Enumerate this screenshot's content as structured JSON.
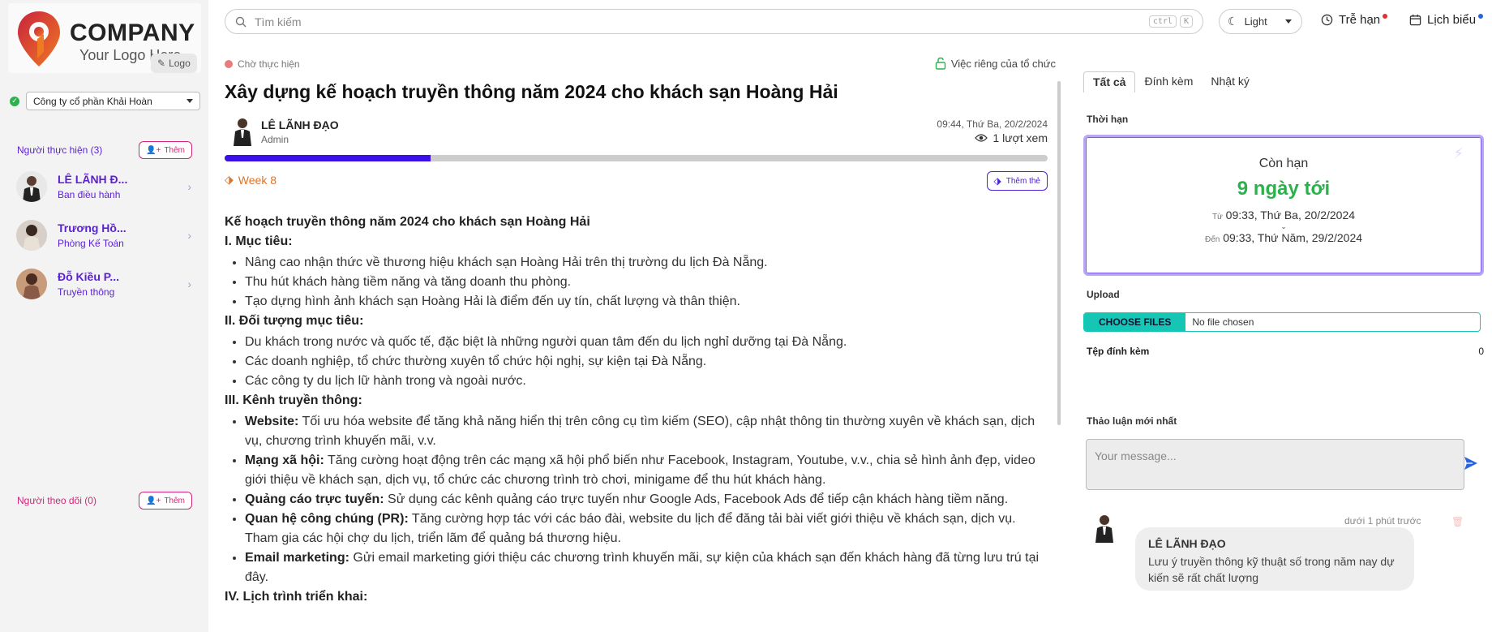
{
  "logo": {
    "company": "COMPANY",
    "tagline": "Your Logo Here",
    "button": "Logo"
  },
  "company_select": {
    "value": "Công ty cổ phần Khải Hoàn"
  },
  "assignees": {
    "label": "Người thực hiện (3)",
    "add": "Thêm",
    "items": [
      {
        "name": "LÊ LÃNH Đ...",
        "role": "Ban điều hành"
      },
      {
        "name": "Trương Hồ...",
        "role": "Phòng Kế Toán"
      },
      {
        "name": "Đỗ Kiều P...",
        "role": "Truyền thông"
      }
    ]
  },
  "followers": {
    "label": "Người theo dõi (0)",
    "add": "Thêm"
  },
  "search": {
    "placeholder": "Tìm kiếm",
    "kbd1": "ctrl",
    "kbd2": "K"
  },
  "topbar": {
    "theme": "Light",
    "overdue": "Trễ hạn",
    "calendar": "Lịch biểu"
  },
  "task": {
    "status": "Chờ thực hiện",
    "privacy": "Việc riêng của tổ chức",
    "title": "Xây dựng kế hoạch truyền thông năm 2024 cho khách sạn Hoàng Hải",
    "author": {
      "name": "LÊ LÃNH ĐẠO",
      "role": "Admin"
    },
    "time": "09:44, Thứ Ba, 20/2/2024",
    "views": "1 lượt xem",
    "progress": 0.25,
    "tag": "Week 8",
    "tag_button": "Thêm thẻ"
  },
  "content": {
    "title": "Kế hoạch truyền thông năm 2024 cho khách sạn Hoàng Hải",
    "s1": "I. Mục tiêu:",
    "s1_items": [
      "Nâng cao nhận thức về thương hiệu khách sạn Hoàng Hải trên thị trường du lịch Đà Nẵng.",
      "Thu hút khách hàng tiềm năng và tăng doanh thu phòng.",
      "Tạo dựng hình ảnh khách sạn Hoàng Hải là điểm đến uy tín, chất lượng và thân thiện."
    ],
    "s2": "II. Đối tượng mục tiêu:",
    "s2_items": [
      "Du khách trong nước và quốc tế, đặc biệt là những người quan tâm đến du lịch nghỉ dưỡng tại Đà Nẵng.",
      "Các doanh nghiệp, tổ chức thường xuyên tổ chức hội nghị, sự kiện tại Đà Nẵng.",
      "Các công ty du lịch lữ hành trong và ngoài nước."
    ],
    "s3": "III. Kênh truyền thông:",
    "s3_items": [
      {
        "b": "Website:",
        "t": " Tối ưu hóa website để tăng khả năng hiển thị trên công cụ tìm kiếm (SEO), cập nhật thông tin thường xuyên về khách sạn, dịch vụ, chương trình khuyến mãi, v.v."
      },
      {
        "b": "Mạng xã hội:",
        "t": " Tăng cường hoạt động trên các mạng xã hội phổ biến như Facebook, Instagram, Youtube, v.v., chia sẻ hình ảnh đẹp, video giới thiệu về khách sạn, dịch vụ, tổ chức các chương trình trò chơi, minigame để thu hút khách hàng."
      },
      {
        "b": "Quảng cáo trực tuyến:",
        "t": " Sử dụng các kênh quảng cáo trực tuyến như Google Ads, Facebook Ads để tiếp cận khách hàng tiềm năng."
      },
      {
        "b": "Quan hệ công chúng (PR):",
        "t": " Tăng cường hợp tác với các báo đài, website du lịch để đăng tải bài viết giới thiệu về khách sạn, dịch vụ. Tham gia các hội chợ du lịch, triển lãm để quảng bá thương hiệu."
      },
      {
        "b": "Email marketing:",
        "t": " Gửi email marketing giới thiệu các chương trình khuyến mãi, sự kiện của khách sạn đến khách hàng đã từng lưu trú tại đây."
      }
    ],
    "s4": "IV. Lịch trình triển khai:"
  },
  "right": {
    "tabs": [
      "Tất cả",
      "Đính kèm",
      "Nhật ký"
    ],
    "deadline_label": "Thời hạn",
    "remain": "Còn hạn",
    "days": "9 ngày tới",
    "from_label": "Từ",
    "from": "09:33, Thứ Ba, 20/2/2024",
    "to_label": "Đến",
    "to": "09:33, Thứ Năm, 29/2/2024",
    "upload_label": "Upload",
    "choose": "CHOOSE FILES",
    "nofile": "No file chosen",
    "attach_label": "Tệp đính kèm",
    "attach_count": "0",
    "discussion_label": "Thảo luận mới nhất",
    "message_placeholder": "Your message...",
    "comment": {
      "time": "dưới 1 phút trước",
      "name": "LÊ LÃNH ĐẠO",
      "text": "Lưu ý truyền thông kỹ thuật số trong năm nay dự kiến sẽ rất chất lượng"
    }
  },
  "colors": {
    "accent": "#5b1fd6",
    "pink": "#d6247a",
    "green": "#2bb24c",
    "teal": "#16c6b5",
    "progress": "#3b10e8",
    "tag": "#e07224"
  }
}
